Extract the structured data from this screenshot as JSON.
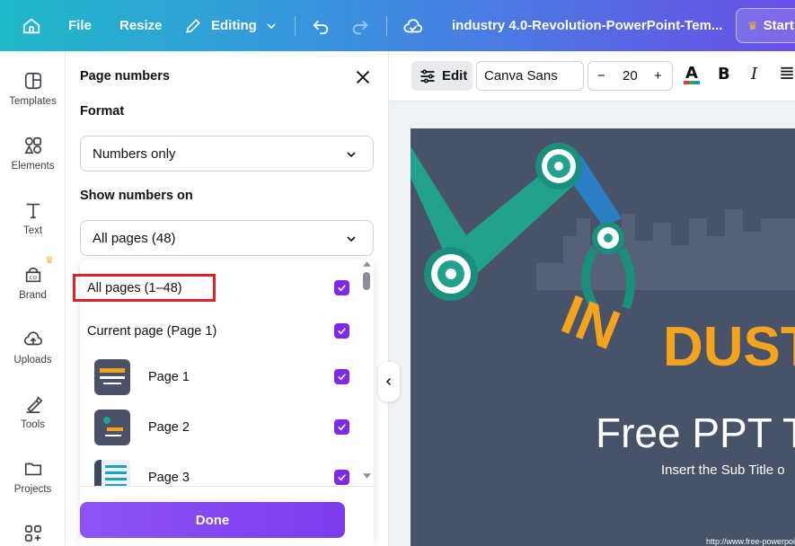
{
  "topbar": {
    "file": "File",
    "resize": "Resize",
    "editing": "Editing",
    "doc_title": "industry 4.0-Revolution-PowerPoint-Tem...",
    "start": "Start"
  },
  "sidebar": {
    "items": [
      {
        "label": "Templates",
        "icon": "templates-icon"
      },
      {
        "label": "Elements",
        "icon": "elements-icon"
      },
      {
        "label": "Text",
        "icon": "text-icon"
      },
      {
        "label": "Brand",
        "icon": "brand-icon"
      },
      {
        "label": "Uploads",
        "icon": "uploads-icon"
      },
      {
        "label": "Tools",
        "icon": "tools-icon"
      },
      {
        "label": "Projects",
        "icon": "projects-icon"
      }
    ]
  },
  "panel": {
    "title": "Page numbers",
    "format_label": "Format",
    "format_value": "Numbers only",
    "show_on_label": "Show numbers on",
    "show_on_value": "All pages (48)",
    "options": {
      "all_pages": "All pages (1–48)",
      "current_page": "Current page (Page 1)",
      "pages": [
        "Page 1",
        "Page 2",
        "Page 3"
      ]
    },
    "done": "Done"
  },
  "toolbar": {
    "edit": "Edit",
    "font": "Canva Sans",
    "font_size": "20",
    "minus": "−",
    "plus": "+"
  },
  "slide": {
    "title": "Free PPT T",
    "subtitle": "Insert the Sub Title o",
    "url": "http://www.free-powerpoi",
    "word_in": "IN",
    "word_dust": "DUST"
  },
  "colors": {
    "accent": "#7d2ae8",
    "highlight": "#e21f26",
    "slide_bg": "#485269",
    "slide_accent": "#f4a31c"
  }
}
